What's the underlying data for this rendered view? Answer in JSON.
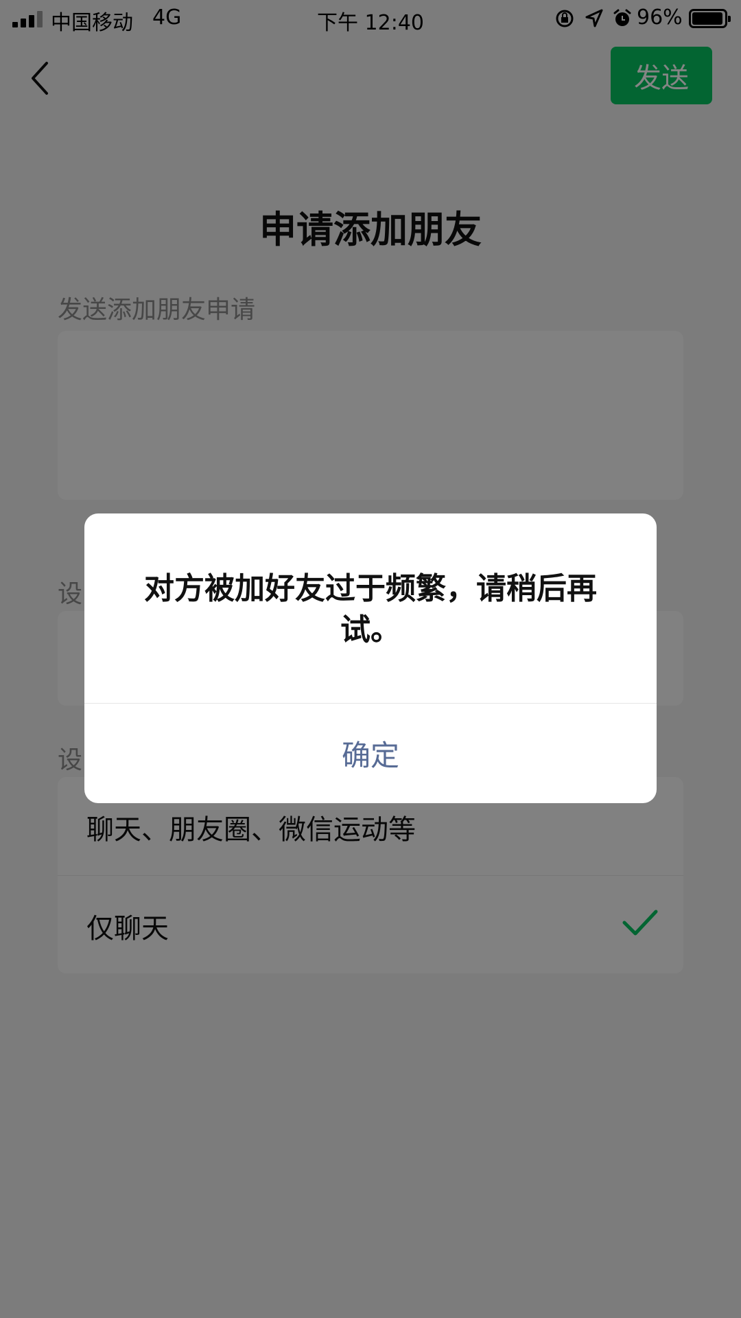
{
  "status_bar": {
    "carrier": "中国移动",
    "network": "4G",
    "time": "下午 12:40",
    "battery_percent": "96%",
    "battery_level": 0.96,
    "icons": [
      "signal-icon",
      "orientation-lock-icon",
      "location-icon",
      "alarm-icon",
      "battery-icon"
    ]
  },
  "nav": {
    "back_icon": "chevron-left-icon",
    "send_label": "发送",
    "send_color": "#07c160"
  },
  "page": {
    "title": "申请添加朋友",
    "request_label": "发送添加朋友申请",
    "remark_label": "设",
    "permission_label": "设",
    "permission_options": [
      {
        "label": "聊天、朋友圈、微信运动等",
        "selected": false
      },
      {
        "label": "仅聊天",
        "selected": true
      }
    ],
    "check_color": "#07c160"
  },
  "dialog": {
    "message": "对方被加好友过于频繁，请稍后再试。",
    "confirm_label": "确定",
    "confirm_color": "#576b95"
  }
}
